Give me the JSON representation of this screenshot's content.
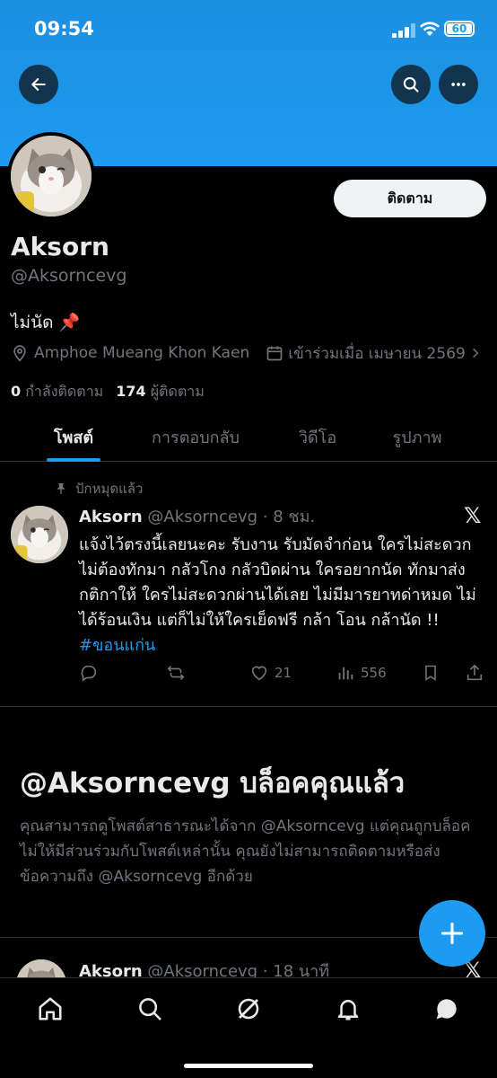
{
  "status_bar": {
    "time": "09:54",
    "battery": "60"
  },
  "profile": {
    "display_name": "Aksorn",
    "handle": "@Aksorncevg",
    "bio": "ไม่นัด 📌",
    "location": "Amphoe Mueang Khon Kaen",
    "joined": "เข้าร่วมเมื่อ เมษายน 2569",
    "following_count": "0",
    "following_label": "กำลังติดตาม",
    "followers_count": "174",
    "followers_label": "ผู้ติดตาม",
    "follow_button": "ติดตาม"
  },
  "tabs": [
    "โพสต์",
    "การตอบกลับ",
    "วิดีโอ",
    "รูปภาพ"
  ],
  "pinned_tweet": {
    "pinned_label": "ปักหมุดแล้ว",
    "author": "Aksorn",
    "handle_time": "@Aksorncevg · 8 ชม.",
    "text": "แจ้งไว้ตรงนี้เลยนะคะ รับงาน รับมัดจำก่อน ใครไม่สะดวกไม่ต้องทักมา กลัวโกง กลัวบิดผ่าน ใครอยากนัด  ทักมาส่งกติกาให้ ใครไม่สะดวกผ่านได้เลย ไม่มีมารยาทด่าหมด ไม่ได้ร้อนเงิน แต่ก็ไม่ให้ใครเย็ดฟรี กล้า โอน กล้านัด  !! ",
    "hashtag": "#ขอนแก่น",
    "likes": "21",
    "views": "556"
  },
  "blocked_notice": {
    "title": "@Aksorncevg บล็อคคุณแล้ว",
    "text": "คุณสามารถดูโพสต์สาธารณะได้จาก @Aksorncevg แต่คุณถูกบล็อคไม่ให้มีส่วนร่วมกับโพสต์เหล่านั้น คุณยังไม่สามารถติดตามหรือส่งข้อความถึง @Aksorncevg อีกด้วย"
  },
  "second_tweet": {
    "author": "Aksorn",
    "handle_time": "@Aksorncevg · 18 นาที"
  },
  "colors": {
    "accent": "#1d9bf0",
    "background": "#000000",
    "muted": "#71767b"
  },
  "icons": {
    "nav": [
      "home-icon",
      "search-icon",
      "grok-icon",
      "bell-icon",
      "messages-icon"
    ],
    "header": [
      "back-arrow-icon",
      "search-icon",
      "more-icon"
    ]
  }
}
